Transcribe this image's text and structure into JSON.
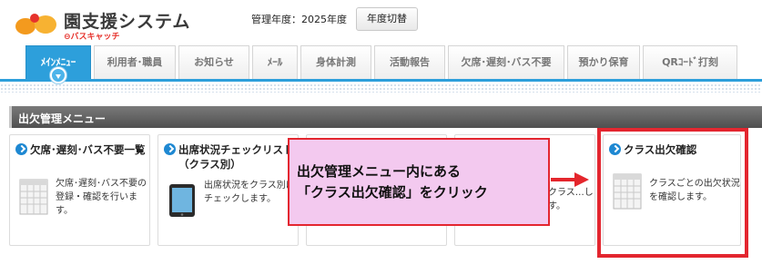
{
  "header": {
    "logo_title": "園支援システム",
    "logo_sub": "⊖バスキャッチ",
    "year_label": "管理年度：2025年度",
    "year_button": "年度切替"
  },
  "tabs": [
    {
      "label": "ﾒｲﾝﾒﾆｭｰ",
      "active": true
    },
    {
      "label": "利用者･職員",
      "active": false
    },
    {
      "label": "お知らせ",
      "active": false
    },
    {
      "label": "ﾒｰﾙ",
      "active": false
    },
    {
      "label": "身体計測",
      "active": false
    },
    {
      "label": "活動報告",
      "active": false
    },
    {
      "label": "欠席･遅刻･バス不要",
      "active": false
    },
    {
      "label": "預かり保育",
      "active": false
    },
    {
      "label": "QRｺｰﾄﾞ打刻",
      "active": false
    }
  ],
  "section": {
    "title": "出欠管理メニュー"
  },
  "cards": [
    {
      "title": "欠席･遅刻･バス不要一覧",
      "desc": "欠席･遅刻･バス不要の登録・確認を行います。",
      "icon": "calendar-icon"
    },
    {
      "title": "出席状況チェックリスト（クラス別）",
      "desc": "出席状況をクラス別にチェックします。",
      "icon": "tablet-icon"
    },
    {
      "title": "",
      "desc": "",
      "icon": "calendar-icon"
    },
    {
      "title": "",
      "desc": "…クラス…します。",
      "icon": "calendar-icon"
    },
    {
      "title": "クラス出欠確認",
      "desc": "クラスごとの出欠状況を確認します。",
      "icon": "calendar-icon"
    }
  ],
  "annotation": {
    "line1": "出欠管理メニュー内にある",
    "line2": "「クラス出欠確認」をクリック"
  },
  "colors": {
    "accent": "#2d9fdb",
    "annotation_red": "#e3262f",
    "callout_bg": "#f3c9ef"
  }
}
